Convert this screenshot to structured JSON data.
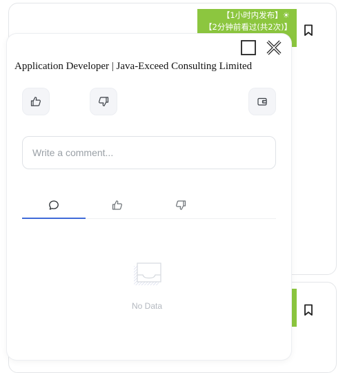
{
  "background_cards": {
    "top": {
      "badge_line1": "【1小时内发布】☀",
      "badge_line2": "【2分钟前看过(共2次)】"
    },
    "bookmark_icon": "bookmark-icon",
    "accent_color": "#8cc63f"
  },
  "modal": {
    "title": "Application Developer | Java-Exceed Consulting Limited",
    "window_buttons": [
      "maximize-icon",
      "close-icon"
    ],
    "actions": [
      "thumbs-up-icon",
      "thumbs-down-icon",
      "wallet-icon"
    ],
    "comment": {
      "placeholder": "Write a comment...",
      "value": ""
    },
    "tabs": [
      {
        "icon": "comment-icon",
        "active": true
      },
      {
        "icon": "thumbs-up-icon",
        "active": false
      },
      {
        "icon": "thumbs-down-icon",
        "active": false
      }
    ],
    "tab_active_color": "#3f6ad8",
    "empty_state": {
      "icon": "empty-inbox-icon",
      "text": "No Data"
    }
  }
}
